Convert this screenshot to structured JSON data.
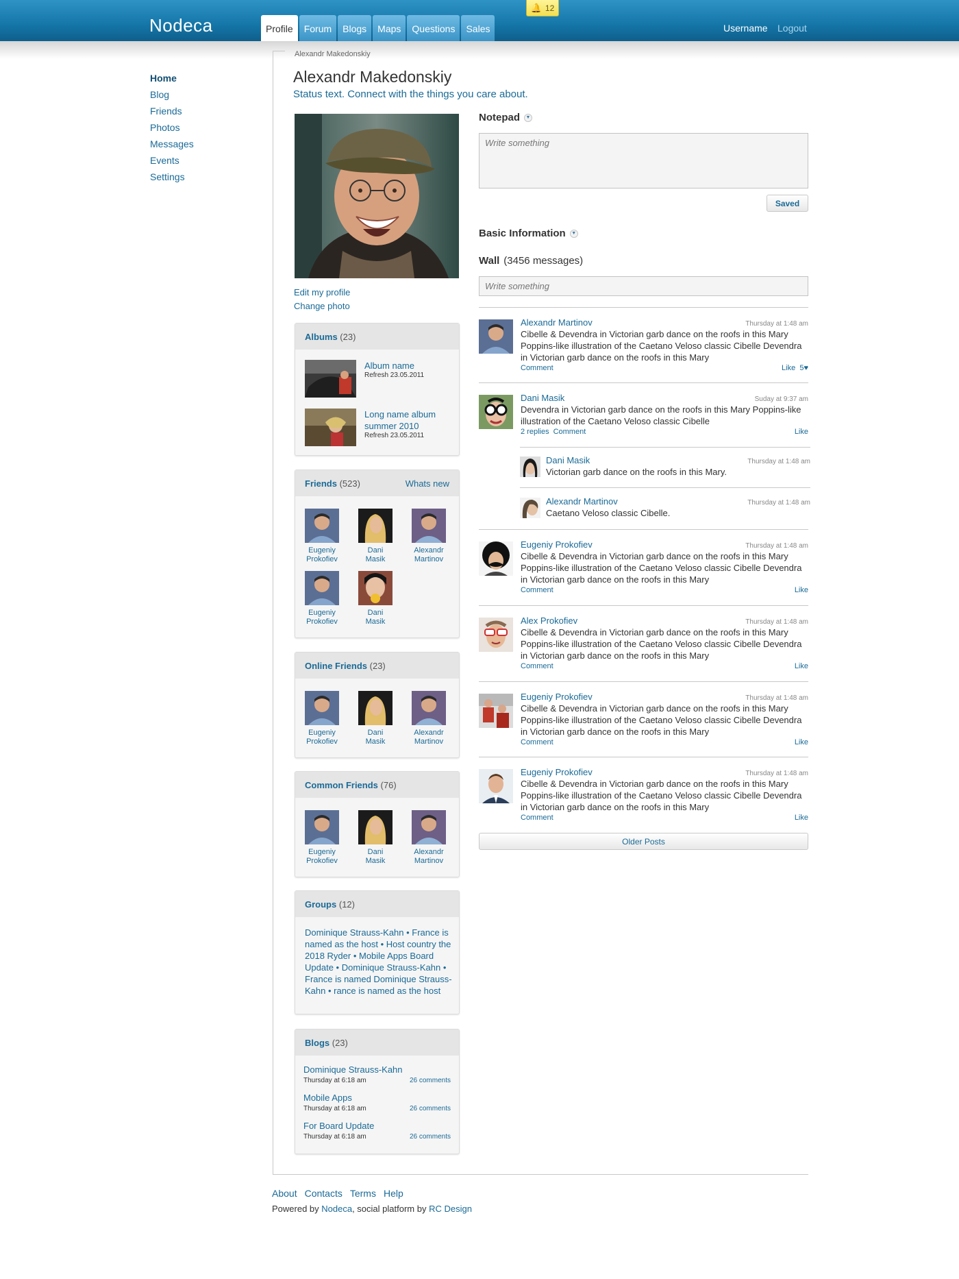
{
  "header": {
    "logo": "Nodeca",
    "tabs": [
      "Profile",
      "Forum",
      "Blogs",
      "Maps",
      "Questions",
      "Sales"
    ],
    "notification_count": "12",
    "username": "Username",
    "logout": "Logout"
  },
  "leftnav": [
    "Home",
    "Blog",
    "Friends",
    "Photos",
    "Messages",
    "Events",
    "Settings"
  ],
  "breadcrumb": "Alexandr Makedonskiy",
  "profile": {
    "name": "Alexandr Makedonskiy",
    "status": "Status text. Connect with the things you care about.",
    "edit_profile": "Edit my profile",
    "change_photo": "Change photo"
  },
  "albums": {
    "title": "Albums",
    "count": "(23)",
    "items": [
      {
        "name": "Album name",
        "date": "Refresh 23.05.2011"
      },
      {
        "name": "Long name album summer 2010",
        "date": "Refresh 23.05.2011"
      }
    ]
  },
  "friends": {
    "title": "Friends",
    "count": "(523)",
    "whats_new": "Whats new",
    "items": [
      {
        "first": "Eugeniy",
        "last": "Prokofiev"
      },
      {
        "first": "Dani",
        "last": "Masik"
      },
      {
        "first": "Alexandr",
        "last": "Martinov"
      },
      {
        "first": "Eugeniy",
        "last": "Prokofiev"
      },
      {
        "first": "Dani",
        "last": "Masik"
      }
    ]
  },
  "online_friends": {
    "title": "Online Friends",
    "count": "(23)",
    "items": [
      {
        "first": "Eugeniy",
        "last": "Prokofiev"
      },
      {
        "first": "Dani",
        "last": "Masik"
      },
      {
        "first": "Alexandr",
        "last": "Martinov"
      }
    ]
  },
  "common_friends": {
    "title": "Common Friends",
    "count": "(76)",
    "items": [
      {
        "first": "Eugeniy",
        "last": "Prokofiev"
      },
      {
        "first": "Dani",
        "last": "Masik"
      },
      {
        "first": "Alexandr",
        "last": "Martinov"
      }
    ]
  },
  "groups": {
    "title": "Groups",
    "count": "(12)",
    "text": "Dominique Strauss-Kahn • France is named as the host • Host country the 2018 Ryder • Mobile Apps Board Update • Dominique Strauss-Kahn • France is named Dominique Strauss-Kahn • rance is named as the host"
  },
  "blogs": {
    "title": "Blogs",
    "count": "(23)",
    "items": [
      {
        "title": "Dominique Strauss-Kahn",
        "time": "Thursday at 6:18 am",
        "comments": "26 comments"
      },
      {
        "title": "Mobile Apps",
        "time": "Thursday at 6:18 am",
        "comments": "26 comments"
      },
      {
        "title": "For Board Update",
        "time": "Thursday at 6:18 am",
        "comments": "26 comments"
      }
    ]
  },
  "notepad": {
    "title": "Notepad",
    "placeholder": "Write something",
    "saved": "Saved"
  },
  "basic_info": {
    "title": "Basic Information"
  },
  "wall": {
    "title": "Wall",
    "count": "(3456 messages)",
    "placeholder": "Write something",
    "older": "Older Posts",
    "posts": [
      {
        "author": "Alexandr Martinov",
        "time": "Thursday at 1:48 am",
        "text": "Cibelle & Devendra in Victorian garb dance on the roofs in this Mary Poppins-like illustration of the Caetano Veloso classic Cibelle Devendra in Victorian garb dance on the roofs in this Mary",
        "comment": "Comment",
        "like": "Like",
        "likes": "5"
      },
      {
        "author": "Dani Masik",
        "time": "Suday at 9:37 am",
        "text": "Devendra in Victorian garb dance on the roofs in this Mary Poppins-like illustration of the Caetano Veloso classic Cibelle",
        "replies": "2 replies",
        "comment": "Comment",
        "like": "Like"
      },
      {
        "author": "Eugeniy Prokofiev",
        "time": "Thursday at 1:48 am",
        "text": "Cibelle & Devendra in Victorian garb dance on the roofs in this Mary Poppins-like illustration of the Caetano Veloso classic Cibelle Devendra in Victorian garb dance on the roofs in this Mary",
        "comment": "Comment",
        "like": "Like"
      },
      {
        "author": "Alex Prokofiev",
        "time": "Thursday at 1:48 am",
        "text": "Cibelle & Devendra in Victorian garb dance on the roofs in this Mary Poppins-like illustration of the Caetano Veloso classic Cibelle Devendra in Victorian garb dance on the roofs in this Mary",
        "comment": "Comment",
        "like": "Like"
      },
      {
        "author": "Eugeniy Prokofiev",
        "time": "Thursday at 1:48 am",
        "text": "Cibelle & Devendra in Victorian garb dance on the roofs in this Mary Poppins-like illustration of the Caetano Veloso classic Cibelle Devendra in Victorian garb dance on the roofs in this Mary",
        "comment": "Comment",
        "like": "Like"
      },
      {
        "author": "Eugeniy Prokofiev",
        "time": "Thursday at 1:48 am",
        "text": "Cibelle & Devendra in Victorian garb dance on the roofs in this Mary Poppins-like illustration of the Caetano Veloso classic Cibelle Devendra in Victorian garb dance on the roofs in this Mary",
        "comment": "Comment",
        "like": "Like"
      }
    ],
    "replies": [
      {
        "author": "Dani Masik",
        "time": "Thursday at 1:48 am",
        "text": "Victorian garb dance on the roofs in this Mary."
      },
      {
        "author": "Alexandr Martinov",
        "time": "Thursday at 1:48 am",
        "text": "Caetano Veloso classic Cibelle."
      }
    ]
  },
  "footer": {
    "links": [
      "About",
      "Contacts",
      "Terms",
      "Help"
    ],
    "powered_prefix": "Powered by ",
    "nodeca": "Nodeca",
    "middle": ", social platform by ",
    "rc": "RC Design"
  }
}
